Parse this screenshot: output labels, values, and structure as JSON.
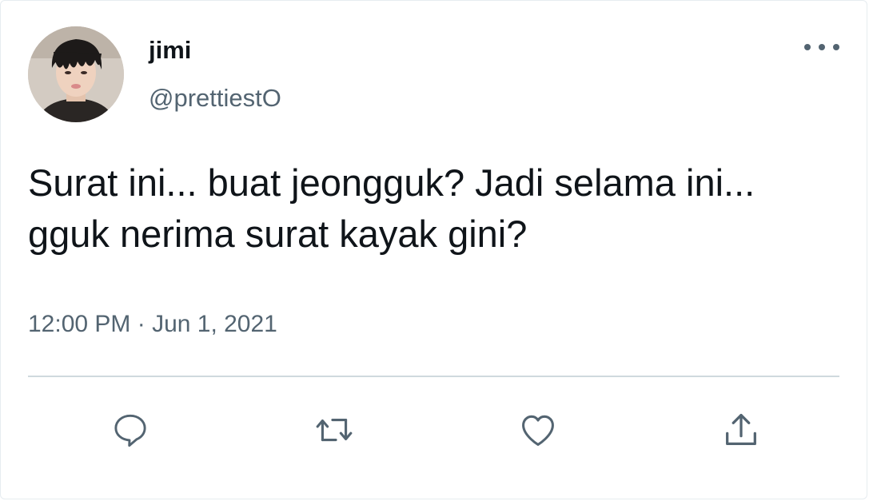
{
  "tweet": {
    "display_name": "jimi",
    "handle": "@prettiestO",
    "text": "Surat ini... buat jeongguk? Jadi selama ini... gguk nerima surat kayak gini?",
    "timestamp": "12:00 PM · Jun 1, 2021"
  },
  "icons": {
    "more": "more-horizontal-icon",
    "reply": "reply-icon",
    "retweet": "retweet-icon",
    "like": "heart-icon",
    "share": "share-icon"
  },
  "colors": {
    "text_primary": "#0f1419",
    "text_secondary": "#536471",
    "divider": "#cfd9de"
  }
}
